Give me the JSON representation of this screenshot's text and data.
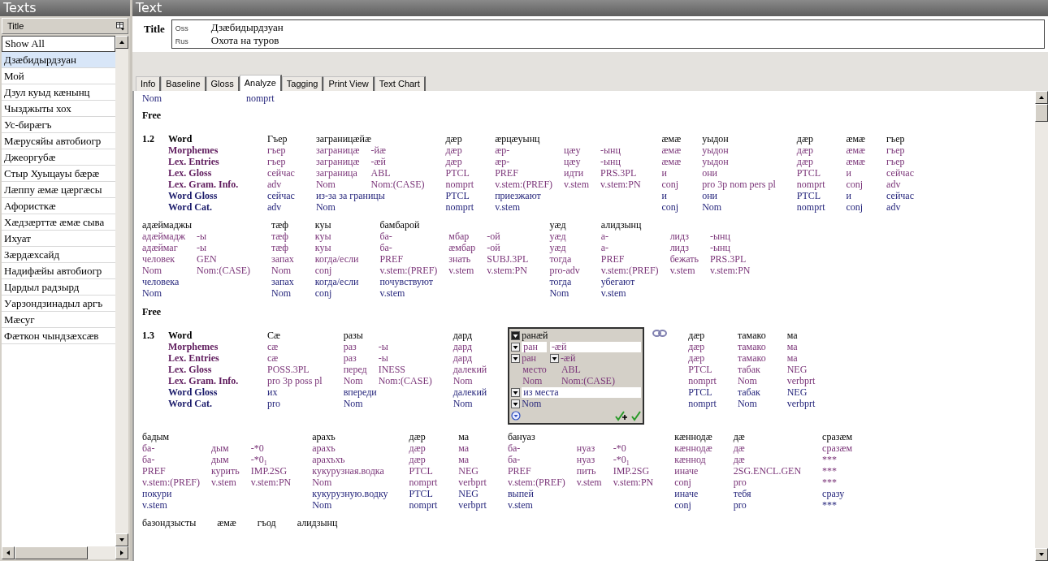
{
  "sidebar": {
    "title": "Texts",
    "column_header": "Title",
    "filter": "Show All",
    "items": [
      {
        "label": "Дзæбидырдзуан",
        "selected": true
      },
      {
        "label": "Мой",
        "selected": false
      },
      {
        "label": "Дзул куыд кæнынц",
        "selected": false
      },
      {
        "label": "Чызджыты хох",
        "selected": false
      },
      {
        "label": "Ус-бирæгъ",
        "selected": false
      },
      {
        "label": "Мæрусяйы автобиогр",
        "selected": false
      },
      {
        "label": "Джеоргубæ",
        "selected": false
      },
      {
        "label": "Стыр Хуыцауы бæрæ",
        "selected": false
      },
      {
        "label": "Лæппу æмæ цæргæсы",
        "selected": false
      },
      {
        "label": "Афористкæ",
        "selected": false
      },
      {
        "label": "Хæдзæрттæ æмæ сыва",
        "selected": false
      },
      {
        "label": "Ихуат",
        "selected": false
      },
      {
        "label": "Зæрдæхсайд",
        "selected": false
      },
      {
        "label": "Надифæйы автобиогр",
        "selected": false
      },
      {
        "label": "Цардыл радзырд",
        "selected": false
      },
      {
        "label": "Уарзондзинадыл аргъ",
        "selected": false
      },
      {
        "label": "Мæсуг",
        "selected": false
      },
      {
        "label": "Фæткон чындзæхсæв",
        "selected": false
      }
    ]
  },
  "text_pane": {
    "title": "Text",
    "title_label": "Title",
    "title_rows": [
      {
        "lang": "Oss",
        "value": "Дзæбидырдзуан"
      },
      {
        "lang": "Rus",
        "value": "Охота на туров"
      }
    ],
    "tabs": [
      {
        "label": "Info",
        "selected": false
      },
      {
        "label": "Baseline",
        "selected": false
      },
      {
        "label": "Gloss",
        "selected": false
      },
      {
        "label": "Analyze",
        "selected": true
      },
      {
        "label": "Tagging",
        "selected": false
      },
      {
        "label": "Print View",
        "selected": false
      },
      {
        "label": "Text Chart",
        "selected": false
      }
    ],
    "previous_tail": {
      "cells": [
        "Nom",
        "nomprt"
      ],
      "free_label": "Free"
    },
    "sentences": [
      {
        "number": "1.2",
        "tier_labels": [
          {
            "label": "Word",
            "kind": "word"
          },
          {
            "label": "Morphemes",
            "kind": "morph"
          },
          {
            "label": "Lex. Entries",
            "kind": "morph"
          },
          {
            "label": "Lex. Gloss",
            "kind": "morph"
          },
          {
            "label": "Lex. Gram. Info.",
            "kind": "morph"
          },
          {
            "label": "Word Gloss",
            "kind": "wgloss"
          },
          {
            "label": "Word Cat.",
            "kind": "wgloss"
          }
        ],
        "free_label": "Free",
        "lines": [
          [
            {
              "kind": "bundle",
              "word": "Гъер",
              "morphs": [
                {
                  "form": "гъер",
                  "entry": "гъер",
                  "gloss": "сейчас",
                  "gram": "adv"
                }
              ],
              "word_gloss": "сейчас",
              "word_cat": "adv"
            },
            {
              "kind": "bundle",
              "word": "заграницæйæ",
              "morphs": [
                {
                  "form": "заграницæ",
                  "entry": "заграницæ",
                  "gloss": "заграница",
                  "gram": "Nom"
                },
                {
                  "form": "-йæ",
                  "entry": "-æй",
                  "gloss": "ABL",
                  "gram": "Nom:(CASE)"
                }
              ],
              "word_gloss": "из-за за границы",
              "word_cat": "Nom"
            },
            {
              "kind": "bundle",
              "word": "дæр",
              "morphs": [
                {
                  "form": "дæр",
                  "entry": "дæр",
                  "gloss": "PTCL",
                  "gram": "nomprt"
                }
              ],
              "word_gloss": "PTCL",
              "word_cat": "nomprt"
            },
            {
              "kind": "bundle",
              "word": "æрцæуынц",
              "morphs": [
                {
                  "form": "æр-",
                  "entry": "æр-",
                  "gloss": "PREF",
                  "gram": "v.stem:(PREF)"
                },
                {
                  "form": "цæу",
                  "entry": "цæу",
                  "gloss": "идти",
                  "gram": "v.stem"
                },
                {
                  "form": "-ынц",
                  "entry": "-ынц",
                  "gloss": "PRS.3PL",
                  "gram": "v.stem:PN"
                }
              ],
              "word_gloss": "приезжают",
              "word_cat": "v.stem"
            },
            {
              "kind": "bundle",
              "word": "æмæ",
              "morphs": [
                {
                  "form": "æмæ",
                  "entry": "æмæ",
                  "gloss": "и",
                  "gram": "conj"
                }
              ],
              "word_gloss": "и",
              "word_cat": "conj"
            },
            {
              "kind": "bundle",
              "word": "уыдон",
              "morphs": [
                {
                  "form": "уыдон",
                  "entry": "уыдон",
                  "gloss": "они",
                  "gram": "pro 3p nom pers pl"
                }
              ],
              "word_gloss": "они",
              "word_cat": "Nom"
            },
            {
              "kind": "bundle",
              "word": "дæр",
              "morphs": [
                {
                  "form": "дæр",
                  "entry": "дæр",
                  "gloss": "PTCL",
                  "gram": "nomprt"
                }
              ],
              "word_gloss": "PTCL",
              "word_cat": "nomprt"
            },
            {
              "kind": "bundle",
              "word": "æмæ",
              "morphs": [
                {
                  "form": "æмæ",
                  "entry": "æмæ",
                  "gloss": "и",
                  "gram": "conj"
                }
              ],
              "word_gloss": "и",
              "word_cat": "conj"
            },
            {
              "kind": "bundle",
              "word": "гъер",
              "morphs": [
                {
                  "form": "гъер",
                  "entry": "гъер",
                  "gloss": "сейчас",
                  "gram": "adv"
                }
              ],
              "word_gloss": "сейчас",
              "word_cat": "adv"
            }
          ],
          [
            {
              "kind": "bundle",
              "word": "адæймаджы",
              "morphs": [
                {
                  "form": "адæймадж",
                  "entry": "адæймаг",
                  "gloss": "человек",
                  "gram": "Nom"
                },
                {
                  "form": "-ы",
                  "entry": "-ы",
                  "gloss": "GEN",
                  "gram": "Nom:(CASE)"
                }
              ],
              "word_gloss": "человека",
              "word_cat": "Nom"
            },
            {
              "kind": "bundle",
              "word": "тæф",
              "morphs": [
                {
                  "form": "тæф",
                  "entry": "тæф",
                  "gloss": "запах",
                  "gram": "Nom"
                }
              ],
              "word_gloss": "запах",
              "word_cat": "Nom"
            },
            {
              "kind": "bundle",
              "word": "куы",
              "morphs": [
                {
                  "form": "куы",
                  "entry": "куы",
                  "gloss": "когда/если",
                  "gram": "conj"
                }
              ],
              "word_gloss": "когда/если",
              "word_cat": "conj"
            },
            {
              "kind": "bundle",
              "word": "бамбарой",
              "morphs": [
                {
                  "form": "ба-",
                  "entry": "ба-",
                  "gloss": "PREF",
                  "gram": "v.stem:(PREF)"
                },
                {
                  "form": "мбар",
                  "entry": "æмбар",
                  "gloss": "знать",
                  "gram": "v.stem"
                },
                {
                  "form": "-ой",
                  "entry": "-ой",
                  "gloss": "SUBJ.3PL",
                  "gram": "v.stem:PN"
                }
              ],
              "word_gloss": "почувствуют",
              "word_cat": "v.stem"
            },
            {
              "kind": "bundle",
              "word": "уæд",
              "morphs": [
                {
                  "form": "уæд",
                  "entry": "уæд",
                  "gloss": "тогда",
                  "gram": "pro-adv"
                }
              ],
              "word_gloss": "тогда",
              "word_cat": "Nom"
            },
            {
              "kind": "bundle",
              "word": "алидзынц",
              "morphs": [
                {
                  "form": "а-",
                  "entry": "а-",
                  "gloss": "PREF",
                  "gram": "v.stem:(PREF)"
                },
                {
                  "form": "лидз",
                  "entry": "лидз",
                  "gloss": "бежать",
                  "gram": "v.stem"
                },
                {
                  "form": "-ынц",
                  "entry": "-ынц",
                  "gloss": "PRS.3PL",
                  "gram": "v.stem:PN"
                }
              ],
              "word_gloss": "убегают",
              "word_cat": "v.stem"
            }
          ]
        ]
      },
      {
        "number": "1.3",
        "tier_labels": [
          {
            "label": "Word",
            "kind": "word"
          },
          {
            "label": "Morphemes",
            "kind": "morph"
          },
          {
            "label": "Lex. Entries",
            "kind": "morph"
          },
          {
            "label": "Lex. Gloss",
            "kind": "morph"
          },
          {
            "label": "Lex. Gram. Info.",
            "kind": "morph"
          },
          {
            "label": "Word Gloss",
            "kind": "wgloss"
          },
          {
            "label": "Word Cat.",
            "kind": "wgloss"
          }
        ],
        "lines": [
          [
            {
              "kind": "bundle",
              "word": "Сæ",
              "morphs": [
                {
                  "form": "сæ",
                  "entry": "сæ",
                  "gloss": "POSS.3PL",
                  "gram": "pro 3p poss pl"
                }
              ],
              "word_gloss": "их",
              "word_cat": "pro"
            },
            {
              "kind": "bundle",
              "word": "разы",
              "morphs": [
                {
                  "form": "раз",
                  "entry": "раз",
                  "gloss": "перед",
                  "gram": "Nom"
                },
                {
                  "form": "-ы",
                  "entry": "-ы",
                  "gloss": "INESS",
                  "gram": "Nom:(CASE)"
                }
              ],
              "word_gloss": "впереди",
              "word_cat": "Nom"
            },
            {
              "kind": "bundle",
              "word": "дард",
              "morphs": [
                {
                  "form": "дард",
                  "entry": "дард",
                  "gloss": "далекий",
                  "gram": "Nom"
                }
              ],
              "word_gloss": "далекий",
              "word_cat": "Nom"
            },
            {
              "kind": "editor",
              "word": "ранæй",
              "morphs": [
                {
                  "form": "ран",
                  "entry": "ран",
                  "gloss": "место",
                  "gram": "Nom"
                },
                {
                  "form": "-æй",
                  "entry": "-æй",
                  "gloss": "ABL",
                  "gram": "Nom:(CASE)"
                }
              ],
              "word_gloss": "из места",
              "word_cat": "Nom"
            },
            {
              "kind": "bundle",
              "word": "дæр",
              "morphs": [
                {
                  "form": "дæр",
                  "entry": "дæр",
                  "gloss": "PTCL",
                  "gram": "nomprt"
                }
              ],
              "word_gloss": "PTCL",
              "word_cat": "nomprt"
            },
            {
              "kind": "bundle",
              "word": "тамако",
              "morphs": [
                {
                  "form": "тамако",
                  "entry": "тамако",
                  "gloss": "табак",
                  "gram": "Nom"
                }
              ],
              "word_gloss": "табак",
              "word_cat": "Nom"
            },
            {
              "kind": "bundle",
              "word": "ма",
              "morphs": [
                {
                  "form": "ма",
                  "entry": "ма",
                  "gloss": "NEG",
                  "gram": "verbprt"
                }
              ],
              "word_gloss": "NEG",
              "word_cat": "verbprt"
            }
          ],
          [
            {
              "kind": "bundle",
              "word": "бадым",
              "morphs": [
                {
                  "form": "ба-",
                  "entry": "ба-",
                  "gloss": "PREF",
                  "gram": "v.stem:(PREF)"
                },
                {
                  "form": "дым",
                  "entry": "дым",
                  "gloss": "курить",
                  "gram": "v.stem"
                },
                {
                  "form": "-*0",
                  "entry": "-*0$_{1}$",
                  "gloss": "IMP.2SG",
                  "gram": "v.stem:PN"
                }
              ],
              "word_gloss": "покури",
              "word_cat": "v.stem"
            },
            {
              "kind": "bundle",
              "word": "арахъ",
              "morphs": [
                {
                  "form": "арахъ",
                  "entry": "арахъхъ",
                  "gloss": "кукурузная.водка",
                  "gram": "Nom"
                }
              ],
              "word_gloss": "кукурузную.водку",
              "word_cat": "Nom"
            },
            {
              "kind": "bundle",
              "word": "дæр",
              "morphs": [
                {
                  "form": "дæр",
                  "entry": "дæр",
                  "gloss": "PTCL",
                  "gram": "nomprt"
                }
              ],
              "word_gloss": "PTCL",
              "word_cat": "nomprt"
            },
            {
              "kind": "bundle",
              "word": "ма",
              "morphs": [
                {
                  "form": "ма",
                  "entry": "ма",
                  "gloss": "NEG",
                  "gram": "verbprt"
                }
              ],
              "word_gloss": "NEG",
              "word_cat": "verbprt"
            },
            {
              "kind": "bundle",
              "word": "бануаз",
              "morphs": [
                {
                  "form": "ба-",
                  "entry": "ба-",
                  "gloss": "PREF",
                  "gram": "v.stem:(PREF)"
                },
                {
                  "form": "нуаз",
                  "entry": "нуаз",
                  "gloss": "пить",
                  "gram": "v.stem"
                },
                {
                  "form": "-*0",
                  "entry": "-*0$_{1}$",
                  "gloss": "IMP.2SG",
                  "gram": "v.stem:PN"
                }
              ],
              "word_gloss": "выпей",
              "word_cat": "v.stem"
            },
            {
              "kind": "bundle",
              "word": "кæннодæ",
              "morphs": [
                {
                  "form": "кæннодæ",
                  "entry": "кæннод",
                  "gloss": "иначе",
                  "gram": "conj"
                }
              ],
              "word_gloss": "иначе",
              "word_cat": "conj"
            },
            {
              "kind": "bundle",
              "word": "дæ",
              "morphs": [
                {
                  "form": "дæ",
                  "entry": "дæ",
                  "gloss": "2SG.ENCL.GEN",
                  "gram": "pro"
                }
              ],
              "word_gloss": "тебя",
              "word_cat": "pro"
            },
            {
              "kind": "bundle",
              "word": "сразæм",
              "morphs": [
                {
                  "form": "сразæм",
                  "entry": "***",
                  "gloss": "***",
                  "gram": "***"
                }
              ],
              "word_gloss": "сразу",
              "word_cat": "***"
            }
          ],
          [
            {
              "kind": "bundle",
              "word": "базондзысты"
            },
            {
              "kind": "bundle",
              "word": "æмæ"
            },
            {
              "kind": "bundle",
              "word": "гъод"
            },
            {
              "kind": "bundle",
              "word": "алидзынц"
            }
          ]
        ]
      }
    ]
  }
}
